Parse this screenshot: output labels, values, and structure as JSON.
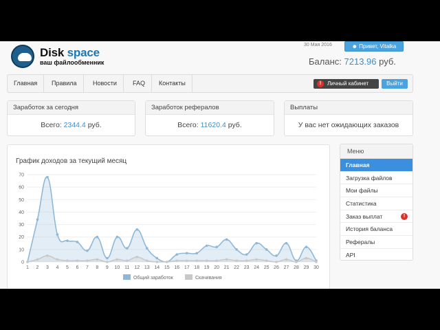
{
  "header": {
    "logo_title_main": "Disk",
    "logo_title_accent": "space",
    "logo_subtitle": "ваш файлообменник",
    "date": "30 Мая 2016",
    "greeting": "Привет, Vitalka",
    "balance_label": "Баланс:",
    "balance_value": "7213.96",
    "balance_currency": "руб."
  },
  "nav": {
    "items": [
      {
        "label": "Главная"
      },
      {
        "label": "Правила"
      },
      {
        "label": "Новости"
      },
      {
        "label": "FAQ"
      },
      {
        "label": "Контакты"
      }
    ],
    "cabinet_label": "Личный кабинет",
    "cabinet_badge": "!",
    "logout_label": "Выйти"
  },
  "panels": {
    "today": {
      "title": "Заработок за сегодня",
      "prefix": "Всего:",
      "value": "2344.4",
      "suffix": "руб."
    },
    "referrals": {
      "title": "Заработок рефералов",
      "prefix": "Всего:",
      "value": "11620.4",
      "suffix": "руб."
    },
    "payouts": {
      "title": "Выплаты",
      "text": "У вас нет ожидающих заказов"
    }
  },
  "menu": {
    "title": "Меню",
    "items": [
      {
        "label": "Главная",
        "active": true
      },
      {
        "label": "Загрузка файлов"
      },
      {
        "label": "Мои файлы"
      },
      {
        "label": "Статистика"
      },
      {
        "label": "Заказ выплат",
        "badge": "!"
      },
      {
        "label": "История баланса"
      },
      {
        "label": "Рефералы"
      },
      {
        "label": "API"
      }
    ]
  },
  "colors": {
    "accent": "#3a8fdf",
    "series_earnings": "#8fb8d8",
    "series_downloads": "#cccccc",
    "badge": "#d9342b"
  },
  "chart_data": {
    "type": "area",
    "title": "График доходов за текущий месяц",
    "x": [
      1,
      2,
      3,
      4,
      5,
      6,
      7,
      8,
      9,
      10,
      11,
      12,
      13,
      14,
      15,
      16,
      17,
      18,
      19,
      20,
      21,
      22,
      23,
      24,
      25,
      26,
      27,
      28,
      29,
      30
    ],
    "ylim": [
      0,
      70
    ],
    "yticks": [
      0,
      10,
      20,
      30,
      40,
      50,
      60,
      70
    ],
    "grid": true,
    "legend_position": "bottom",
    "series": [
      {
        "name": "Общий заработок",
        "values": [
          0,
          34,
          68,
          22,
          17,
          16,
          9,
          20,
          3,
          20,
          11,
          26,
          11,
          3,
          0,
          6,
          7,
          7,
          13,
          12,
          18,
          10,
          6,
          15,
          10,
          5,
          15,
          1,
          12,
          1
        ]
      },
      {
        "name": "Скачивания",
        "values": [
          0,
          2,
          5,
          2,
          1,
          1,
          1,
          2,
          0,
          2,
          1,
          4,
          1,
          0,
          0,
          1,
          1,
          1,
          1,
          1,
          2,
          1,
          1,
          2,
          1,
          0,
          2,
          0,
          3,
          0
        ]
      }
    ]
  }
}
